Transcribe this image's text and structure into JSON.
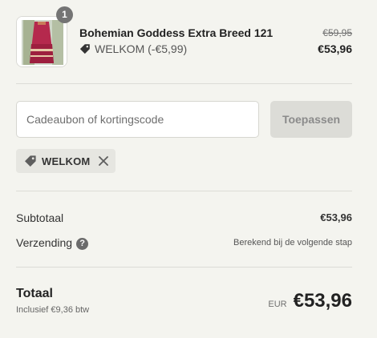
{
  "line_item": {
    "quantity": "1",
    "name": "Bohemian Goddess Extra Breed 121",
    "discount_label": "WELKOM (-€5,99)",
    "original_price": "€59,95",
    "price": "€53,96",
    "thumbnail_icon": "skirt-product-photo"
  },
  "discount": {
    "placeholder": "Cadeaubon of kortingscode",
    "value": "",
    "apply_label": "Toepassen",
    "applied_code": "WELKOM"
  },
  "summary": {
    "subtotal_label": "Subtotaal",
    "subtotal_value": "€53,96",
    "shipping_label": "Verzending",
    "shipping_help": "?",
    "shipping_value": "Berekend bij de volgende stap"
  },
  "total": {
    "label": "Totaal",
    "tax_note": "Inclusief €9,36 btw",
    "currency": "EUR",
    "amount": "€53,96"
  },
  "colors": {
    "background": "#f4f4ef",
    "divider": "#dcdcd6",
    "badge": "#747474",
    "button_disabled": "#dcdcd7"
  }
}
